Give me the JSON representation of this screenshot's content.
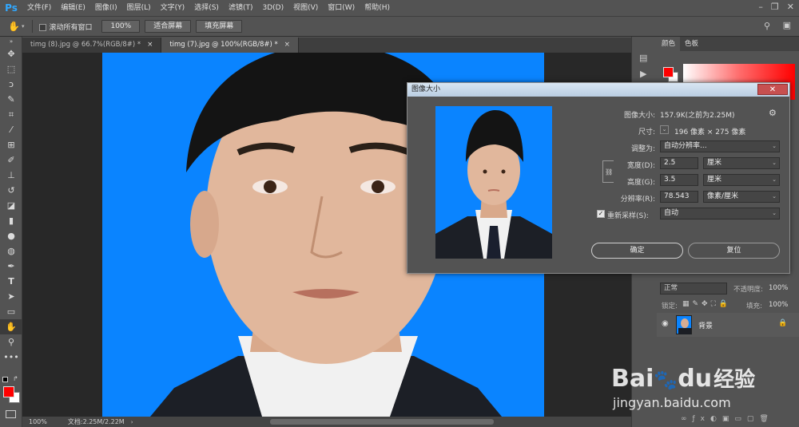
{
  "app": {
    "logo": "Ps"
  },
  "menu": [
    "文件(F)",
    "编辑(E)",
    "图像(I)",
    "图层(L)",
    "文字(Y)",
    "选择(S)",
    "滤镜(T)",
    "3D(D)",
    "视图(V)",
    "窗口(W)",
    "帮助(H)"
  ],
  "options": {
    "scroll_all": "滚动所有窗口",
    "zoom_btn": "100%",
    "fit_btn": "适合屏幕",
    "fill_btn": "填充屏幕"
  },
  "tabs": [
    {
      "label": "timg (8).jpg @ 66.7%(RGB/8#) *",
      "close": "×"
    },
    {
      "label": "timg (7).jpg @ 100%(RGB/8#) *",
      "close": "×"
    }
  ],
  "status": {
    "zoom": "100%",
    "doc": "文档:2.25M/2.22M"
  },
  "right_panel": {
    "color_tab": "颜色",
    "swatch_tab": "色板",
    "blend_mode": "正常",
    "opacity_label": "不透明度:",
    "opacity_value": "100%",
    "lock_label": "锁定:",
    "fill_label": "填充:",
    "fill_value": "100%",
    "layer_name": "背景"
  },
  "dialog": {
    "title": "图像大小",
    "close": "✕",
    "image_size_label": "图像大小:",
    "image_size_value": "157.9K(之前为2.25M)",
    "dims_label": "尺寸:",
    "dims_value": "196 像素 × 275 像素",
    "fit_label": "调整为:",
    "fit_value": "自动分辨率...",
    "width_label": "宽度(D):",
    "width_value": "2.5",
    "width_unit": "厘米",
    "height_label": "高度(G):",
    "height_value": "3.5",
    "height_unit": "厘米",
    "res_label": "分辨率(R):",
    "res_value": "78.543",
    "res_unit": "像素/厘米",
    "resample_label": "重新采样(S):",
    "resample_value": "自动",
    "ok": "确定",
    "reset": "复位"
  },
  "watermark": {
    "brand": "Bai",
    "brand2": "du",
    "jingyan": "经验",
    "url": "jingyan.baidu.com"
  },
  "colors": {
    "accent": "#31a8ff",
    "photo_bg": "#0a84ff",
    "fg_color": "#ff0000"
  }
}
